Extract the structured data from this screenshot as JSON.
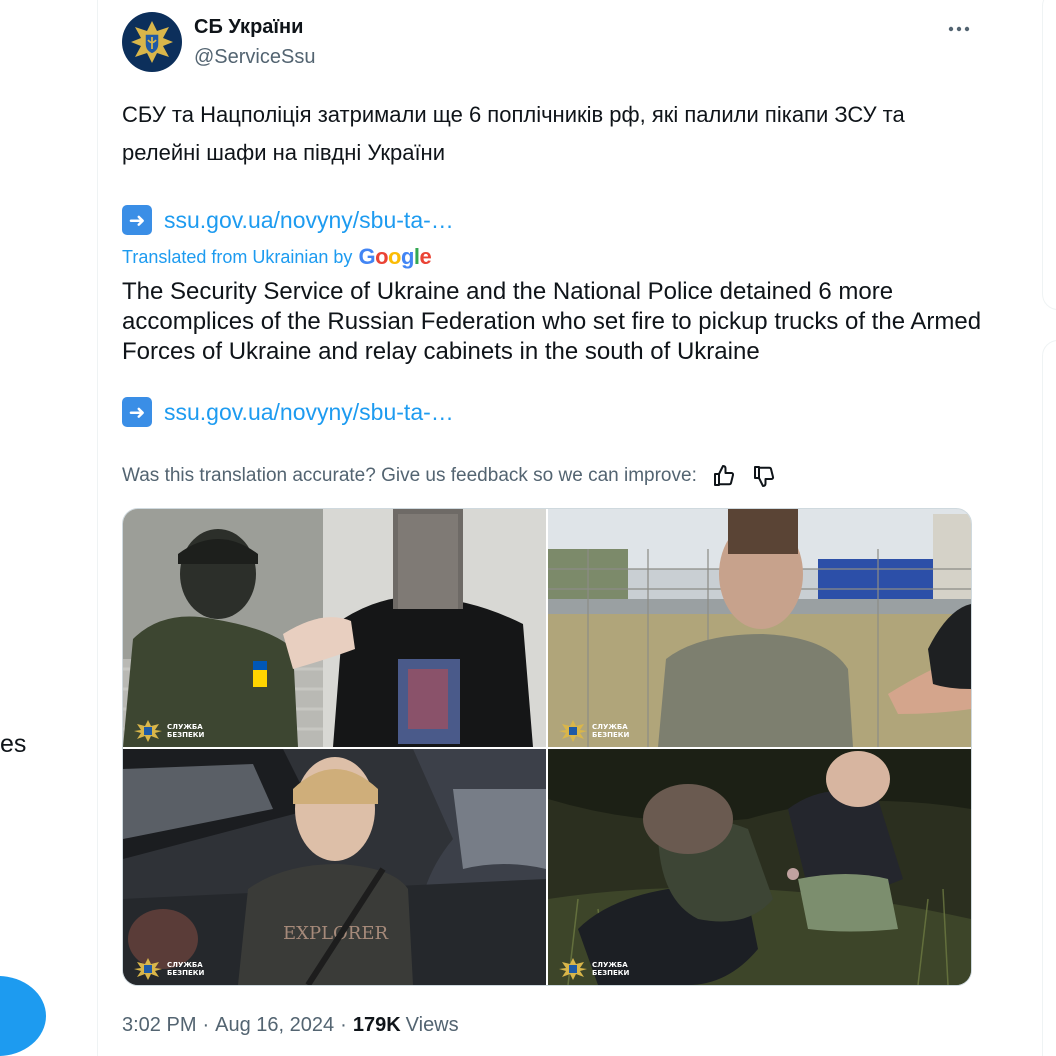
{
  "account": {
    "display_name": "СБ України",
    "handle": "@ServiceSsu",
    "avatar_icon": "ssu-emblem-icon",
    "brand_color": "#0c2f5b"
  },
  "tweet": {
    "text": "СБУ та Нацполіція затримали ще 6 поплічників рф, які палили пікапи ЗСУ та релейні шафи на півдні України",
    "link_text": "ssu.gov.ua/novyny/sbu-ta-…",
    "translated_from": "Translated from Ukrainian by",
    "translator_brand": "Google",
    "translated_text": "The Security Service of Ukraine and the National Police detained 6 more accomplices of the Russian Federation who set fire to pickup trucks of the Armed Forces of Ukraine and relay cabinets in the south of Ukraine",
    "translated_link_text": "ssu.gov.ua/novyny/sbu-ta-…",
    "feedback_prompt": "Was this translation accurate? Give us feedback so we can improve:"
  },
  "media": {
    "watermark_text_line1": "СЛУЖБА",
    "watermark_text_line2": "БЕЗПЕКИ",
    "photos": [
      {
        "scene": "officer-with-detainee-by-steps"
      },
      {
        "scene": "detainee-by-fence-outdoors"
      },
      {
        "scene": "detainee-by-car"
      },
      {
        "scene": "two-detainees-at-night"
      }
    ]
  },
  "meta": {
    "time": "3:02 PM",
    "separator": "·",
    "date": "Aug 16, 2024",
    "views_count": "179K",
    "views_label": "Views"
  },
  "left_edge_text": "es",
  "colors": {
    "link": "#1d9bf0",
    "secondary_text": "#536471",
    "primary_text": "#0f1419"
  }
}
